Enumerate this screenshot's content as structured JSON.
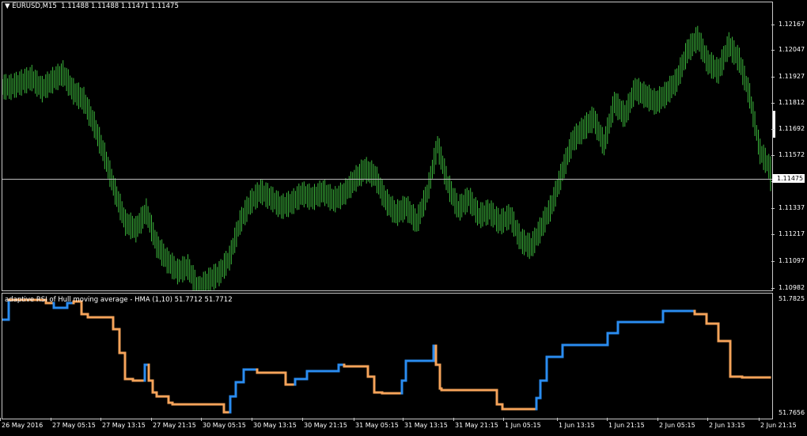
{
  "header": {
    "symbol": "EURUSD,M15",
    "ohlc": "1.11488 1.11488 1.11471 1.11475"
  },
  "price_axis": {
    "labels": [
      "1.12167",
      "1.12047",
      "1.11927",
      "1.11812",
      "1.11692",
      "1.11572",
      "1.11452",
      "1.11337",
      "1.11217",
      "1.11097",
      "1.10982"
    ],
    "current_price": "1.11475"
  },
  "indicator": {
    "title": "adaptive RSI of Hull moving average - HMA (1,10) 51.7712 51.7712",
    "axis_top": "51.7825",
    "axis_bottom": "51.7656",
    "colors": {
      "up": "#2a8cf0",
      "down": "#f5a35a"
    }
  },
  "time_axis": {
    "labels": [
      "26 May 2016",
      "27 May 05:15",
      "27 May 13:15",
      "27 May 21:15",
      "30 May 05:15",
      "30 May 13:15",
      "30 May 21:15",
      "31 May 05:15",
      "31 May 13:15",
      "31 May 21:15",
      "1 Jun 05:15",
      "1 Jun 13:15",
      "1 Jun 21:15",
      "2 Jun 05:15",
      "2 Jun 13:15",
      "2 Jun 21:15"
    ]
  },
  "colors": {
    "bars": "#3cb83c",
    "background": "#000000",
    "grid": "#c8c8c8"
  },
  "chart_data": {
    "type": "line",
    "title": "EURUSD,M15",
    "ylim": [
      1.10982,
      1.12167
    ],
    "series": [
      {
        "close": [
          1.1189,
          1.1191,
          1.1193,
          1.1188,
          1.1192,
          1.1195,
          1.1187,
          1.1183,
          1.1172,
          1.1158,
          1.1142,
          1.1128,
          1.1125,
          1.1133,
          1.1118,
          1.1111,
          1.1106,
          1.1108,
          1.1098,
          1.1102,
          1.1105,
          1.1112,
          1.1128,
          1.1137,
          1.1142,
          1.1139,
          1.1135,
          1.1137,
          1.1141,
          1.1139,
          1.1142,
          1.1138,
          1.1141,
          1.1147,
          1.1152,
          1.1149,
          1.1138,
          1.1132,
          1.1135,
          1.1128,
          1.1141,
          1.1163,
          1.1145,
          1.1134,
          1.1139,
          1.1131,
          1.1133,
          1.1128,
          1.1131,
          1.112,
          1.1117,
          1.1126,
          1.1136,
          1.1151,
          1.1165,
          1.117,
          1.1175,
          1.1163,
          1.1182,
          1.1176,
          1.1188,
          1.1185,
          1.1182,
          1.1186,
          1.1192,
          1.1205,
          1.1211,
          1.12,
          1.1196,
          1.1208,
          1.1201,
          1.1185,
          1.116,
          1.1152,
          1.1148
        ]
      }
    ]
  }
}
